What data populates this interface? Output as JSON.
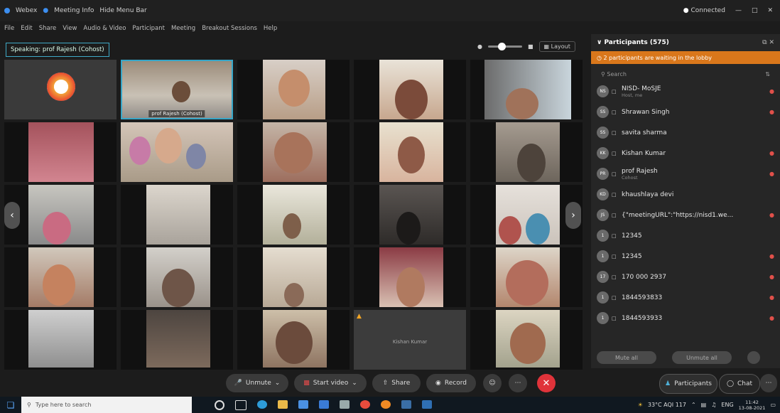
{
  "titlebar": {
    "app_label": "Webex",
    "meeting_info": "Meeting Info",
    "hide_menu": "Hide Menu Bar",
    "connection": "Connected"
  },
  "menu": [
    "File",
    "Edit",
    "Share",
    "View",
    "Audio & Video",
    "Participant",
    "Meeting",
    "Breakout Sessions",
    "Help"
  ],
  "speaking": "Speaking: prof Rajesh (Cohost)",
  "view": {
    "layout_label": "Layout"
  },
  "grid": {
    "selected_label": "prof Rajesh (Cohost)",
    "muted_tile_label": "Kishan Kumar"
  },
  "panel": {
    "title": "Participants (575)",
    "waiting_banner": "2 participants are waiting in the lobby",
    "search_placeholder": "Search",
    "participants": [
      {
        "initials": "NS",
        "name": "NISD- MoSJE",
        "sub": "Host, me",
        "mic": "●"
      },
      {
        "initials": "SS",
        "name": "Shrawan Singh",
        "sub": "",
        "mic": "●"
      },
      {
        "initials": "SS",
        "name": "savita sharma",
        "sub": "",
        "mic": ""
      },
      {
        "initials": "KK",
        "name": "Kishan Kumar",
        "sub": "",
        "mic": "●"
      },
      {
        "initials": "PR",
        "name": "prof Rajesh",
        "sub": "Cohost",
        "mic": "●"
      },
      {
        "initials": "KD",
        "name": "khaushlaya devi",
        "sub": "",
        "mic": ""
      },
      {
        "initials": "JS",
        "name": "{\"meetingURL\":\"https://nisd1.we...",
        "sub": "",
        "mic": "●"
      },
      {
        "initials": "1",
        "name": "12345",
        "sub": "",
        "mic": ""
      },
      {
        "initials": "1",
        "name": "12345",
        "sub": "",
        "mic": "●"
      },
      {
        "initials": "17",
        "name": "170 000 2937",
        "sub": "",
        "mic": "●"
      },
      {
        "initials": "1",
        "name": "1844593833",
        "sub": "",
        "mic": "●"
      },
      {
        "initials": "1",
        "name": "1844593933",
        "sub": "",
        "mic": "●"
      }
    ],
    "mute_all": "Mute all",
    "unmute_all": "Unmute all"
  },
  "toolbar": {
    "unmute": "Unmute",
    "start_video": "Start video",
    "share": "Share",
    "record": "Record",
    "participants": "Participants",
    "chat": "Chat"
  },
  "taskbar": {
    "search_placeholder": "Type here to search",
    "weather": "33°C AQI 117",
    "lang": "ENG",
    "time": "11:42",
    "date": "13-08-2021"
  }
}
